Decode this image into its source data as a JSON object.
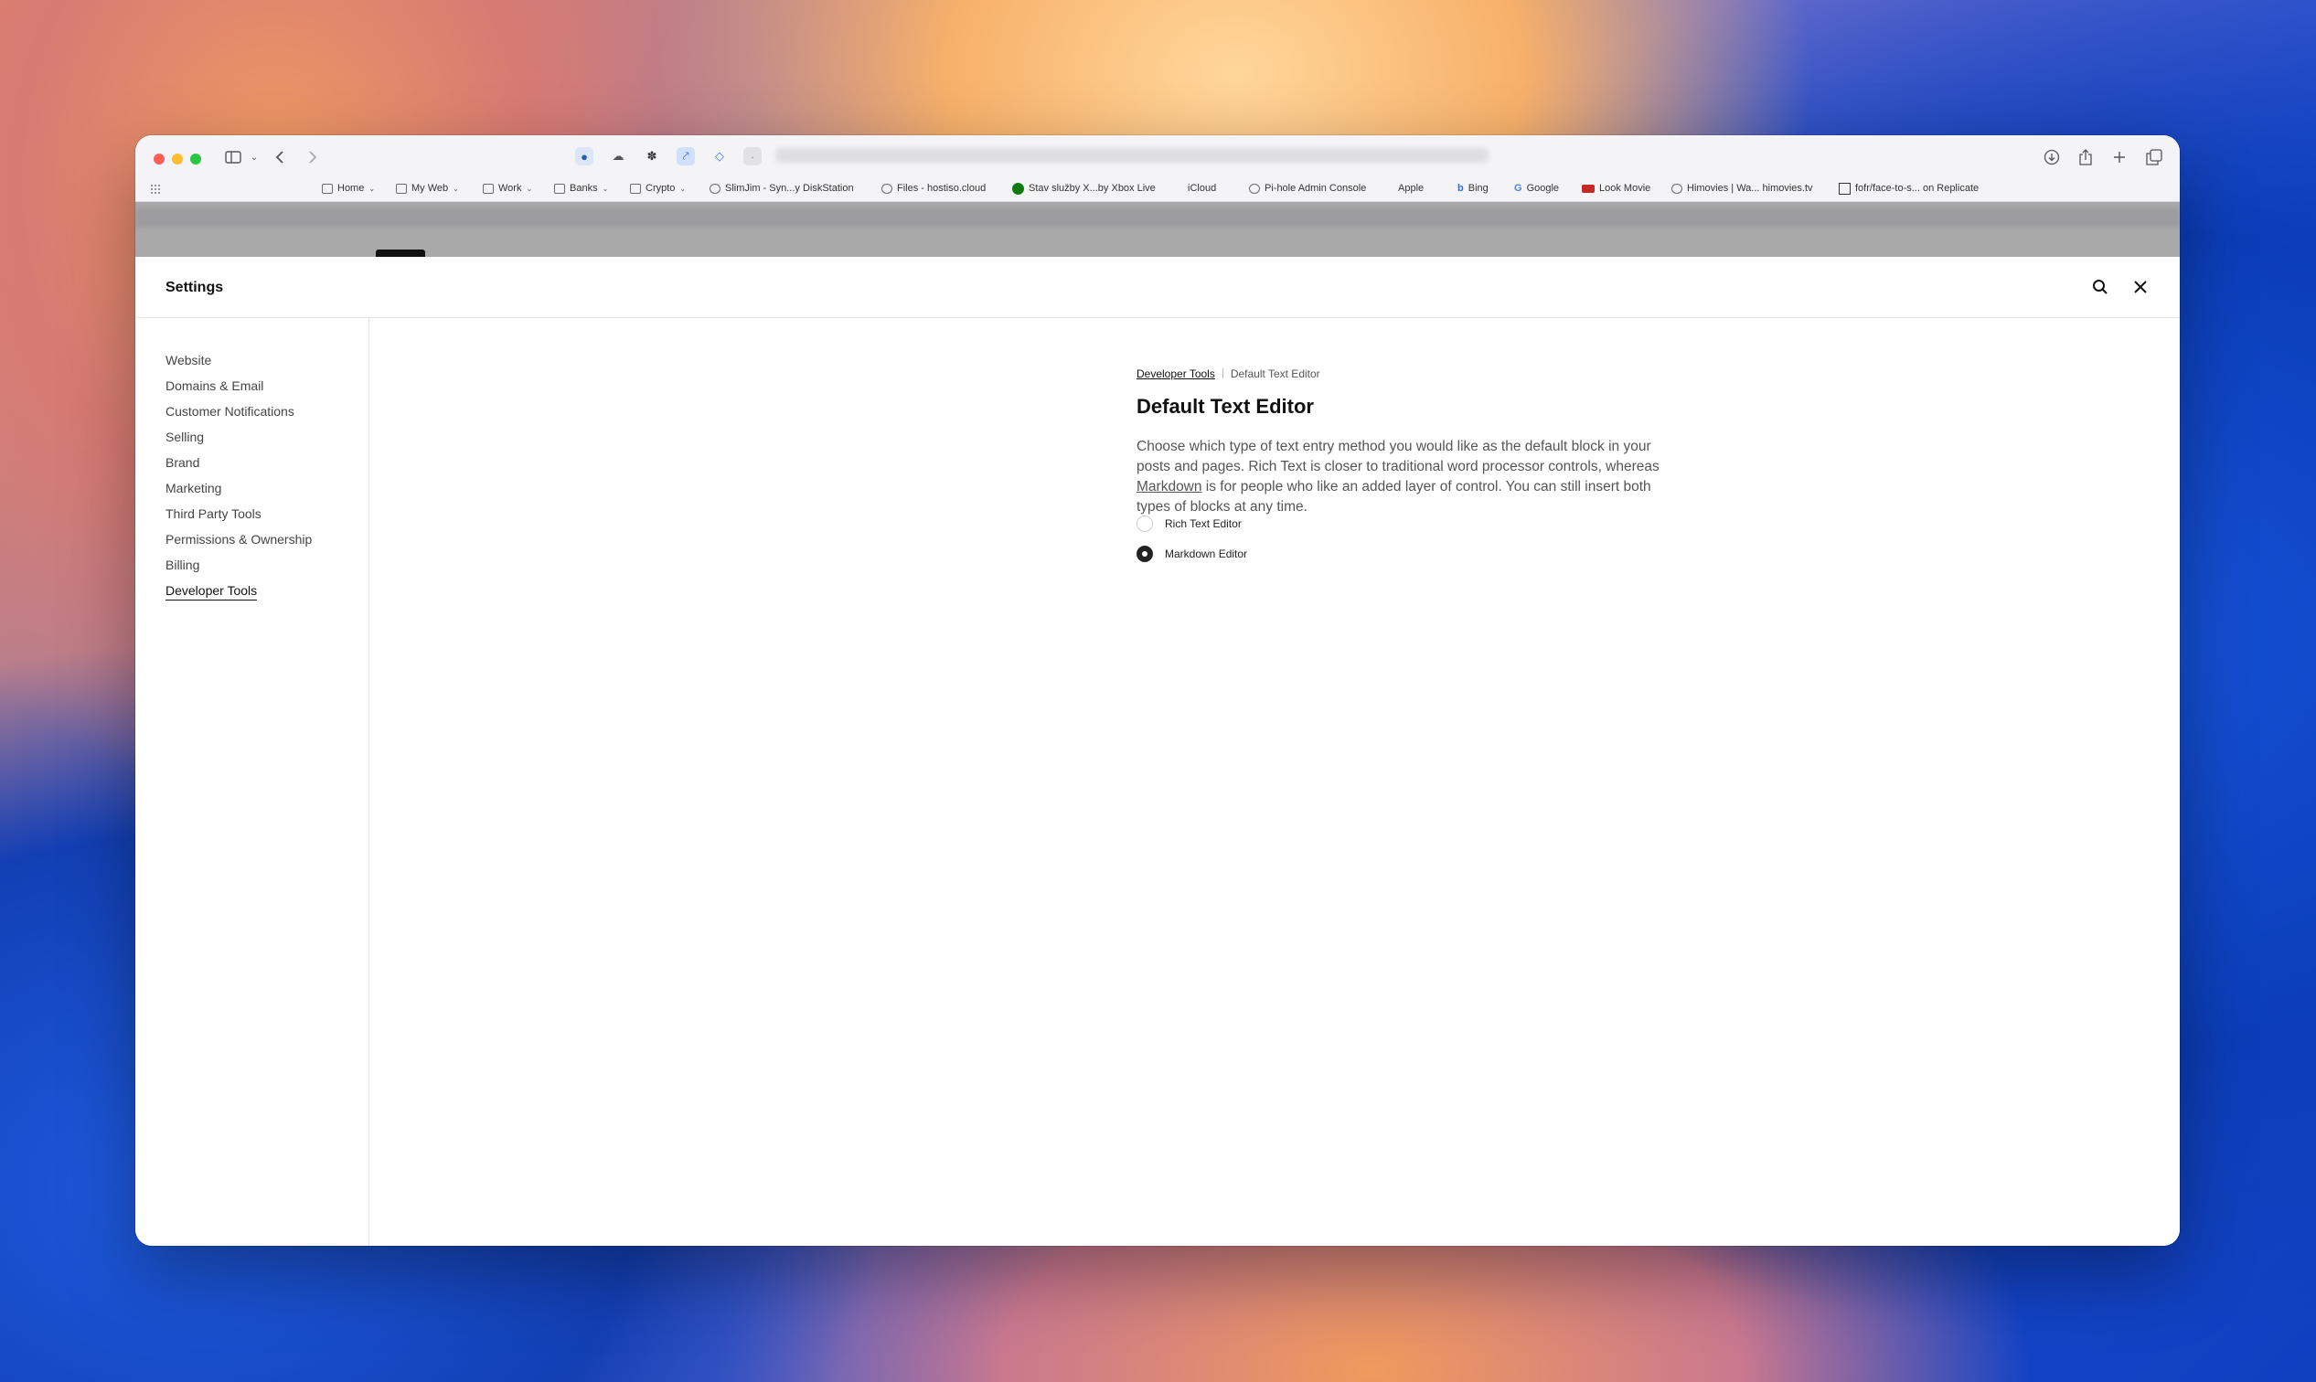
{
  "browser": {
    "bookmarks": [
      {
        "label": "Home",
        "type": "folder"
      },
      {
        "label": "My Web",
        "type": "folder"
      },
      {
        "label": "Work",
        "type": "folder"
      },
      {
        "label": "Banks",
        "type": "folder"
      },
      {
        "label": "Crypto",
        "type": "folder"
      },
      {
        "label": "SlimJim - Syn...y DiskStation",
        "type": "globe"
      },
      {
        "label": "Files - hostiso.cloud",
        "type": "globe"
      },
      {
        "label": "Stav služby X...by Xbox Live",
        "type": "xbox"
      },
      {
        "label": "iCloud",
        "type": "apple"
      },
      {
        "label": "Pi-hole Admin Console",
        "type": "globe"
      },
      {
        "label": "Apple",
        "type": "apple"
      },
      {
        "label": "Bing",
        "type": "bing"
      },
      {
        "label": "Google",
        "type": "google"
      },
      {
        "label": "Look Movie",
        "type": "lookmovie"
      },
      {
        "label": "Himovies | Wa... himovies.tv",
        "type": "globe"
      },
      {
        "label": "fofr/face-to-s... on Replicate",
        "type": "replicate"
      }
    ]
  },
  "settings": {
    "title": "Settings",
    "nav": [
      {
        "label": "Website"
      },
      {
        "label": "Domains & Email"
      },
      {
        "label": "Customer Notifications"
      },
      {
        "label": "Selling"
      },
      {
        "label": "Brand"
      },
      {
        "label": "Marketing"
      },
      {
        "label": "Third Party Tools"
      },
      {
        "label": "Permissions & Ownership"
      },
      {
        "label": "Billing"
      },
      {
        "label": "Developer Tools"
      }
    ],
    "active_nav": "Developer Tools",
    "breadcrumb": {
      "parent": "Developer Tools",
      "current": "Default Text Editor"
    },
    "page_title": "Default Text Editor",
    "description": {
      "before": "Choose which type of text entry method you would like as the default block in your posts and pages. Rich Text is closer to traditional word processor controls, whereas ",
      "link": "Markdown",
      "after": " is for people who like an added layer of control. You can still insert both types of blocks at any time."
    },
    "options": [
      {
        "label": "Rich Text Editor",
        "selected": false
      },
      {
        "label": "Markdown Editor",
        "selected": true
      }
    ]
  }
}
